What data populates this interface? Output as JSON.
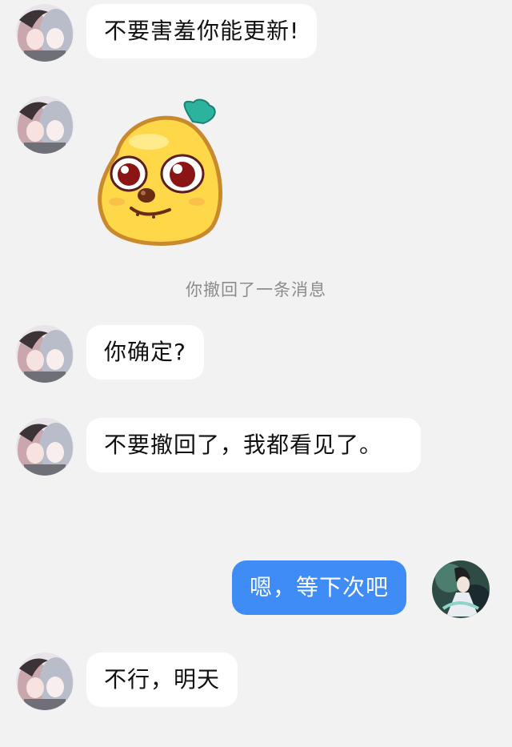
{
  "theme": {
    "background": "#f2f2f2",
    "incoming_bubble": "#ffffff",
    "outgoing_bubble": "#3f8cf7",
    "system_text": "#8c8c8c"
  },
  "messages": [
    {
      "text": "不要害羞你能更新!"
    },
    {
      "sticker": "smiling-potato-face-sticker"
    },
    {
      "system": "你撤回了一条消息"
    },
    {
      "text": "你确定?"
    },
    {
      "text": "不要撤回了，我都看见了。"
    },
    {
      "text": "嗯，等下次吧"
    },
    {
      "text": "不行，明天"
    }
  ],
  "avatars": {
    "contact": "anime-girls-avatar",
    "self": "anime-character-avatar"
  }
}
